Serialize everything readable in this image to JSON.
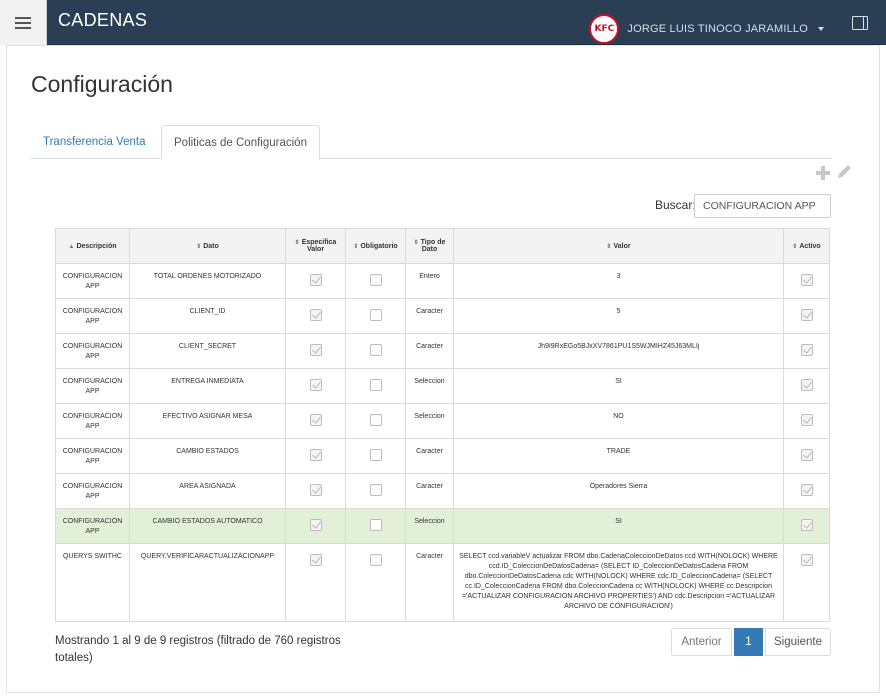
{
  "header": {
    "app_title": "CADENAS",
    "user_name": "JORGE LUIS TINOCO JARAMILLO",
    "avatar_text": "KFC"
  },
  "page": {
    "title": "Configuración",
    "tabs": [
      "Transferencia Venta",
      "Politicas de Configuración"
    ],
    "active_tab": "Politicas de Configuración"
  },
  "search": {
    "label": "Buscar:",
    "value": "CONFIGURACION APP"
  },
  "table": {
    "columns": [
      "Descripción",
      "Dato",
      "Especifica Valor",
      "Obligatorio",
      "Tipo de Dato",
      "Valor",
      "Activo"
    ],
    "rows": [
      {
        "descripcion": "CONFIGURACION APP",
        "dato": "TOTAL ORDENES MOTORIZADO",
        "especifica": true,
        "obligatorio": false,
        "tipo": "Entero",
        "valor": "3",
        "activo": true
      },
      {
        "descripcion": "CONFIGURACION APP",
        "dato": "CLIENT_ID",
        "especifica": true,
        "obligatorio": false,
        "tipo": "Caracter",
        "valor": "5",
        "activo": true
      },
      {
        "descripcion": "CONFIGURACION APP",
        "dato": "CLIENT_SECRET",
        "especifica": true,
        "obligatorio": false,
        "tipo": "Caracter",
        "valor": "Jh9I9RxEGo5BJxXV7861PU1S5WJMIHZ45J63MLIj",
        "activo": true
      },
      {
        "descripcion": "CONFIGURACION APP",
        "dato": "ENTREGA INMEDIATA",
        "especifica": true,
        "obligatorio": false,
        "tipo": "Seleccion",
        "valor": "SI",
        "activo": true
      },
      {
        "descripcion": "CONFIGURACION APP",
        "dato": "EFECTIVO ASIGNAR MESA",
        "especifica": true,
        "obligatorio": false,
        "tipo": "Seleccion",
        "valor": "NO",
        "activo": true
      },
      {
        "descripcion": "CONFIGURACION APP",
        "dato": "CAMBIO ESTADOS",
        "especifica": true,
        "obligatorio": false,
        "tipo": "Caracter",
        "valor": "TRADE",
        "activo": true
      },
      {
        "descripcion": "CONFIGURACION APP",
        "dato": "AREA ASIGNADA",
        "especifica": true,
        "obligatorio": false,
        "tipo": "Caracter",
        "valor": "Operadores Sierra",
        "activo": true
      },
      {
        "descripcion": "CONFIGURACION APP",
        "dato": "CAMBIO ESTADOS AUTOMATICO",
        "especifica": true,
        "obligatorio": false,
        "tipo": "Seleccion",
        "valor": "SI",
        "activo": true
      },
      {
        "descripcion": "QUERYS SWITHC",
        "dato": "QUERY.VERIFICARACTUALIZACIONAPP",
        "especifica": true,
        "obligatorio": false,
        "tipo": "Caracter",
        "valor": "SELECT ccd.variableV actualizar FROM dbo.CadenaColeccionDeDatos ccd WITH(NOLOCK) WHERE ccd.ID_ColeccionDeDatosCadena= (SELECT ID_ColeccionDeDatosCadena FROM dbo.ColeccionDeDatosCadena cdc WITH(NOLOCK) WHERE cdc.ID_ColeccionCadena= (SELECT cc.ID_ColeccionCadena FROM dbo.ColeccionCadena cc WITH(NOLOCK) WHERE cc.Descripcion ='ACTUALIZAR CONFIGURACION ARCHIVO PROPERTIES') AND cdc.Descripcion ='ACTUALIZAR ARCHIVO DE CONFIGURACION')",
        "activo": true
      }
    ]
  },
  "footer": {
    "info": "Mostrando 1 al 9 de 9 registros (filtrado de 760 registros totales)",
    "prev_label": "Anterior",
    "page_number": "1",
    "next_label": "Siguiente"
  },
  "colors": {
    "topbar": "#2a3f54",
    "link": "#337ab7",
    "highlight_row": "#e1f0d7"
  }
}
